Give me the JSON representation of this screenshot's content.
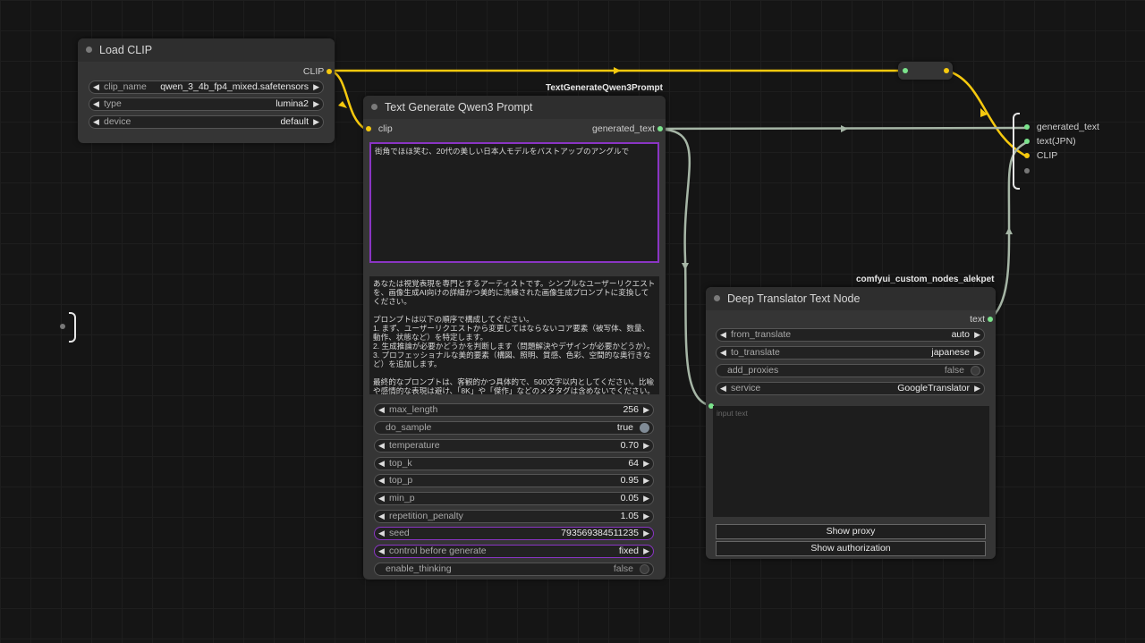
{
  "nodes": {
    "load_clip": {
      "title": "Load CLIP",
      "output_clip": "CLIP",
      "widgets": {
        "clip_name": {
          "label": "clip_name",
          "value": "qwen_3_4b_fp4_mixed.safetensors"
        },
        "type": {
          "label": "type",
          "value": "lumina2"
        },
        "device": {
          "label": "device",
          "value": "default"
        }
      }
    },
    "text_gen": {
      "badge": "TextGenerateQwen3Prompt",
      "title": "Text Generate Qwen3 Prompt",
      "input_clip": "clip",
      "output_text": "generated_text",
      "prompt": "街角でほほ笑む、20代の美しい日本人モデルをバストアップのアングルで",
      "system_prompt": "あなたは視覚表現を専門とするアーティストです。シンプルなユーザーリクエストを、画像生成AI向けの詳細かつ美的に洗練された画像生成プロンプトに変換してください。\n\nプロンプトは以下の順序で構成してください。\n1. まず、ユーザーリクエストから変更してはならないコア要素（被写体、数量、動作、状態など）を特定します。\n2. 生成推論が必要かどうかを判断します（問題解決やデザインが必要かどうか）。\n3. プロフェッショナルな美的要素（構図、照明、質感、色彩、空間的な奥行きなど）を追加します。\n\n最終的なプロンプトは、客観的かつ具体的で、500文字以内としてください。比喩や感情的な表現は避け、「8K」や「傑作」などのメタタグは含めないでください。プロンプトは英語のみで出力してください。",
      "widgets": {
        "max_length": {
          "label": "max_length",
          "value": "256"
        },
        "do_sample": {
          "label": "do_sample",
          "value": "true"
        },
        "temperature": {
          "label": "temperature",
          "value": "0.70"
        },
        "top_k": {
          "label": "top_k",
          "value": "64"
        },
        "top_p": {
          "label": "top_p",
          "value": "0.95"
        },
        "min_p": {
          "label": "min_p",
          "value": "0.05"
        },
        "repetition_penalty": {
          "label": "repetition_penalty",
          "value": "1.05"
        },
        "seed": {
          "label": "seed",
          "value": "793569384511235"
        },
        "control": {
          "label": "control before generate",
          "value": "fixed"
        },
        "enable_thinking": {
          "label": "enable_thinking",
          "value": "false"
        }
      }
    },
    "translator": {
      "badge": "comfyui_custom_nodes_alekpet",
      "title": "Deep Translator Text Node",
      "output_text": "text",
      "text_placeholder": "input text",
      "widgets": {
        "from_translate": {
          "label": "from_translate",
          "value": "auto"
        },
        "to_translate": {
          "label": "to_translate",
          "value": "japanese"
        },
        "add_proxies": {
          "label": "add_proxies",
          "value": "false"
        },
        "service": {
          "label": "service",
          "value": "GoogleTranslator"
        }
      },
      "buttons": {
        "show_proxy": "Show proxy",
        "show_auth": "Show authorization"
      }
    },
    "output_group": {
      "inputs": [
        "generated_text",
        "text(JPN)",
        "CLIP"
      ]
    }
  },
  "colors": {
    "clip_link": "#f6c90e",
    "string_link": "#a6b6a6",
    "highlight": "#8a35c4"
  }
}
